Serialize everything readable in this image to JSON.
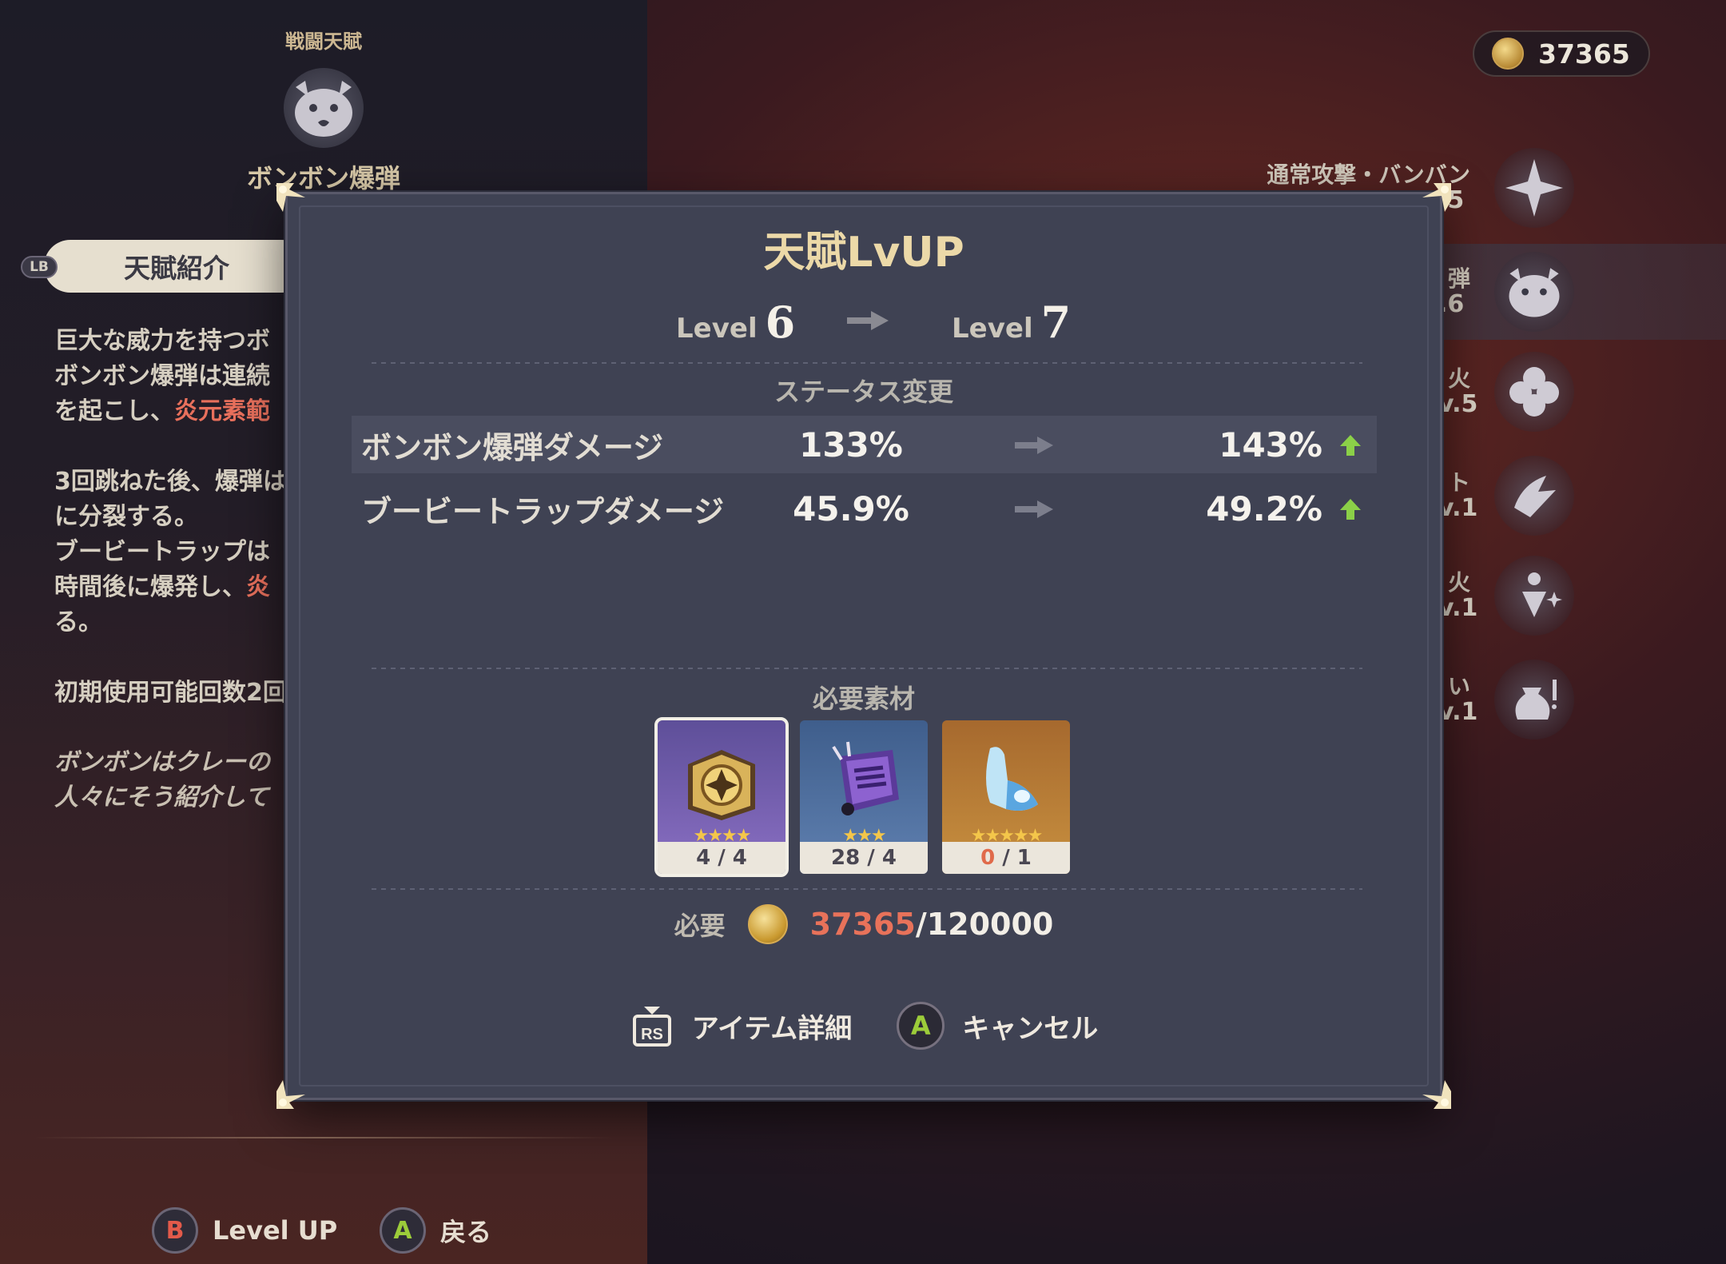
{
  "left_panel": {
    "heading": "戦闘天賦",
    "talent_name": "ボンボン爆弾",
    "tab_button": "LB",
    "tab_label": "天賦紹介",
    "description_lines": [
      {
        "text": "巨大な威力を持つボ",
        "red": ""
      },
      {
        "text": "ボンボン爆弾は連続",
        "red": ""
      },
      {
        "text": "を起こし、",
        "red": "炎元素範"
      },
      {
        "text": "",
        "red": ""
      },
      {
        "text": "3回跳ねた後、爆弾は",
        "red": ""
      },
      {
        "text": "に分裂する。",
        "red": ""
      },
      {
        "text": "ブービートラップは",
        "red": ""
      },
      {
        "text": "時間後に爆発し、",
        "red": "炎"
      },
      {
        "text": "る。",
        "red": ""
      },
      {
        "text": "",
        "red": ""
      },
      {
        "text": "初期使用可能回数2回",
        "red": ""
      }
    ],
    "flavor_lines": [
      "ボンボンはクレーの",
      "人々にそう紹介して"
    ],
    "buttons": {
      "b_key": "B",
      "b_label": "Level UP",
      "a_key": "A",
      "a_label": "戻る"
    }
  },
  "mora": {
    "amount": "37365"
  },
  "talent_list": [
    {
      "name": "通常攻撃・バンバン",
      "level": ".5",
      "icon": "normal-attack-icon"
    },
    {
      "name": "弾",
      "level": ".6",
      "icon": "bomb-icon"
    },
    {
      "name": "火",
      "level": "v.5",
      "icon": "clover-icon"
    },
    {
      "name": "ト",
      "level": "v.1",
      "icon": "passive-icon"
    },
    {
      "name": "火",
      "level": "v.1",
      "icon": "sparkle-icon"
    },
    {
      "name": "い",
      "level": "v.1",
      "icon": "pouch-icon"
    }
  ],
  "modal": {
    "title": "天賦LvUP",
    "level_label": "Level",
    "level_from": "6",
    "level_to": "7",
    "status_label": "ステータス変更",
    "stats": [
      {
        "name": "ボンボン爆弾ダメージ",
        "old": "133%",
        "new": "143%"
      },
      {
        "name": "ブービートラップダメージ",
        "old": "45.9%",
        "new": "49.2%"
      }
    ],
    "materials_label": "必要素材",
    "materials": [
      {
        "name": "talent-book",
        "stars": "★★★★",
        "have": "4",
        "need": "4",
        "insufficient": false
      },
      {
        "name": "scroll",
        "stars": "★★★",
        "have": "28",
        "need": "4",
        "insufficient": false
      },
      {
        "name": "crystal-shoe",
        "stars": "★★★★★",
        "have": "0",
        "need": "1",
        "insufficient": true
      }
    ],
    "need_label": "必要",
    "mora_have": "37365",
    "mora_need": "/120000",
    "item_detail_key": "RS",
    "item_detail_label": "アイテム詳細",
    "cancel_key": "A",
    "cancel_label": "キャンセル"
  },
  "colors": {
    "accent_gold": "#ecd9a8",
    "insufficient_red": "#e8725a",
    "up_green": "#8bd048",
    "modal_bg": "#3f4253"
  }
}
